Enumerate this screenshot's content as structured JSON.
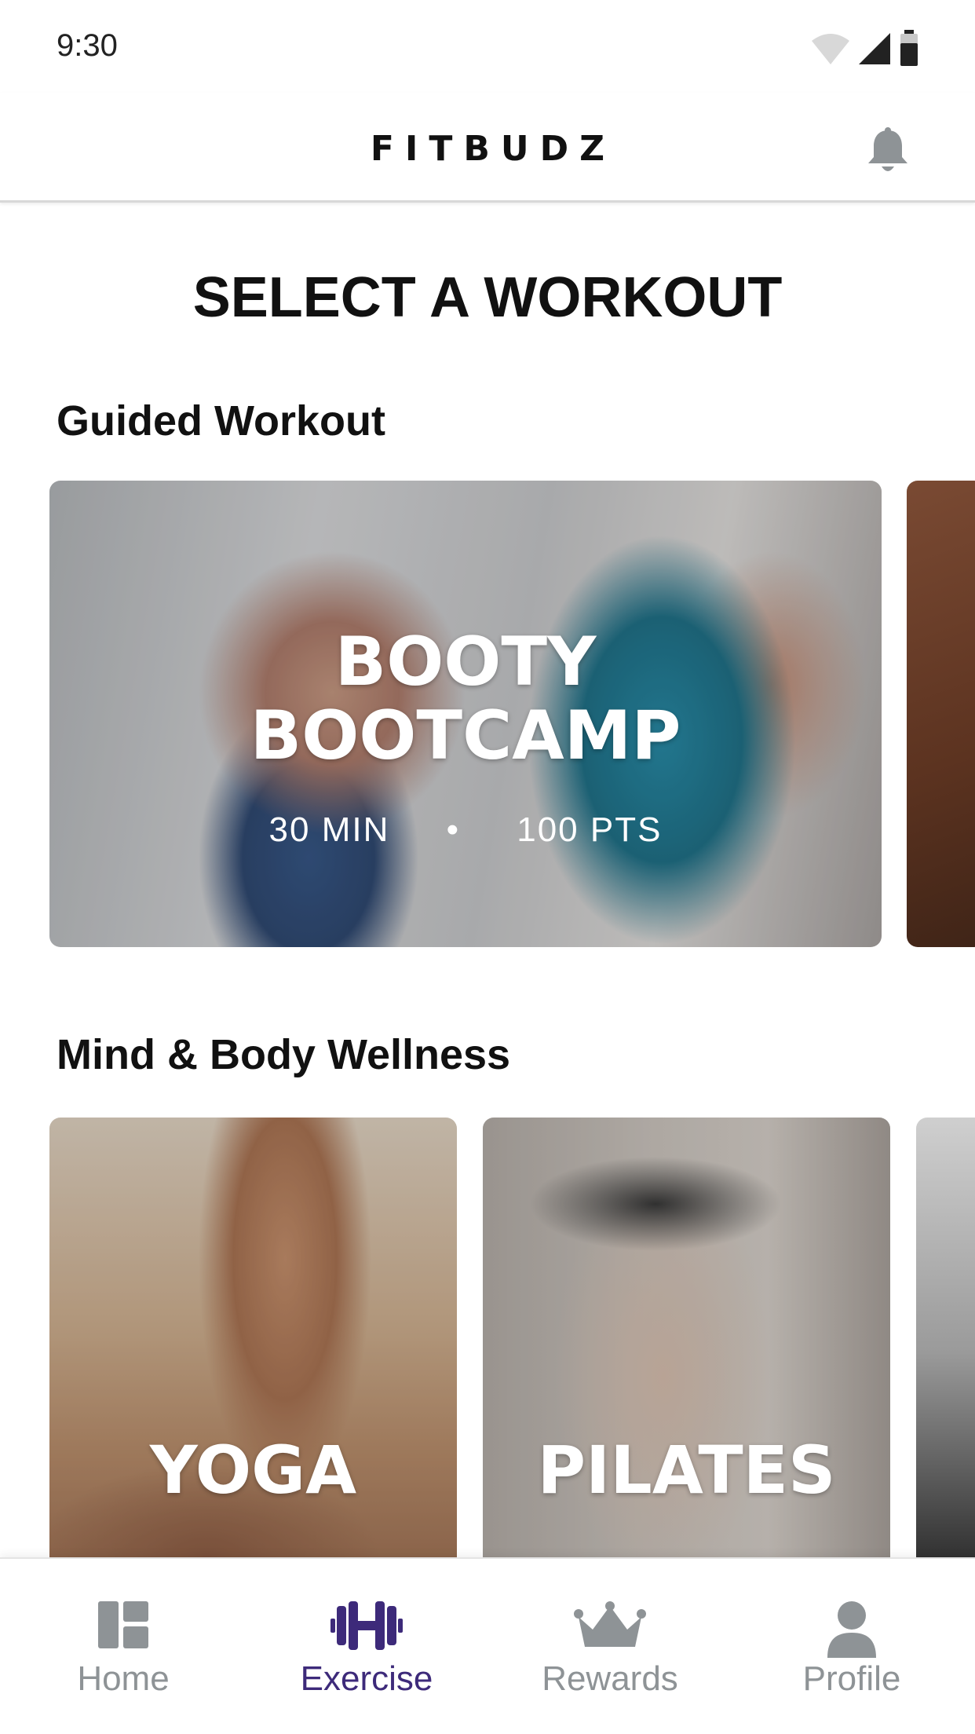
{
  "status_bar": {
    "time": "9:30"
  },
  "header": {
    "app_name": "FITBUDZ"
  },
  "page": {
    "title": "SELECT A WORKOUT"
  },
  "sections": {
    "guided": {
      "title": "Guided Workout",
      "featured": {
        "title_line1": "BOOTY",
        "title_line2": "BOOTCAMP",
        "duration": "30 MIN",
        "separator": "•",
        "points": "100 PTS"
      }
    },
    "wellness": {
      "title": "Mind & Body Wellness",
      "cards": [
        {
          "label": "YOGA"
        },
        {
          "label": "PILATES"
        }
      ]
    }
  },
  "tab_bar": {
    "tabs": [
      {
        "label": "Home",
        "icon": "dashboard-icon",
        "active": false
      },
      {
        "label": "Exercise",
        "icon": "dumbbell-icon",
        "active": true
      },
      {
        "label": "Rewards",
        "icon": "crown-icon",
        "active": false
      },
      {
        "label": "Profile",
        "icon": "person-icon",
        "active": false
      }
    ]
  },
  "colors": {
    "accent": "#3d2a7a",
    "inactive": "#8e9396",
    "text": "#111111"
  }
}
